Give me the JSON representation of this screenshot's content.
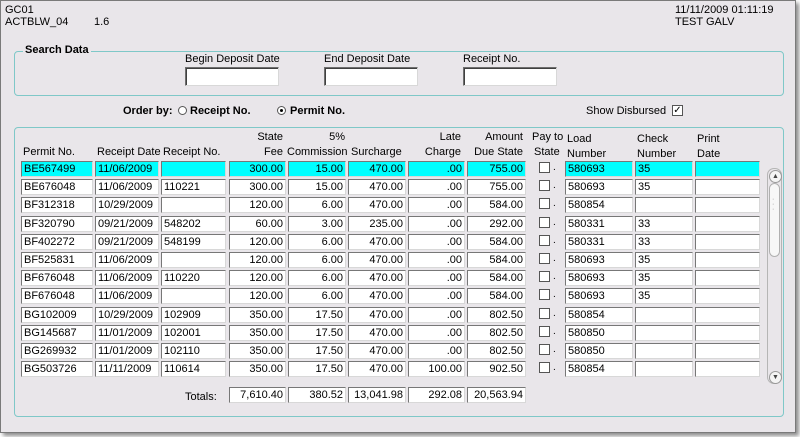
{
  "header": {
    "form_code": "GC01",
    "program": "ACTBLW_04",
    "version": "1.6",
    "datetime": "11/11/2009 01:11:19",
    "environment": "TEST GALV"
  },
  "search": {
    "title": "Search Data",
    "begin_label": "Begin Deposit Date",
    "begin_value": "",
    "end_label": "End Deposit Date",
    "end_value": "",
    "receipt_label": "Receipt No.",
    "receipt_value": ""
  },
  "order": {
    "label": "Order by:",
    "option_receipt": "Receipt No.",
    "option_permit": "Permit No.",
    "selected": "permit"
  },
  "show_disbursed": {
    "label": "Show Disbursed",
    "checked": true,
    "glyph": "✓"
  },
  "columns": {
    "permit": "Permit No.",
    "receipt_date": "Receipt Date",
    "receipt_no": "Receipt No.",
    "state_fee_1": "State",
    "state_fee_2": "Fee",
    "commission_1": "5%",
    "commission_2": "Commission",
    "surcharge": "Surcharge",
    "late_1": "Late",
    "late_2": "Charge",
    "amount_1": "Amount",
    "amount_2": "Due State",
    "pay_1": "Pay to",
    "pay_2": "State",
    "load_1": "Load",
    "load_2": "Number",
    "check_1": "Check",
    "check_2": "Number",
    "print_1": "Print",
    "print_2": "Date"
  },
  "rows": [
    {
      "permit": "BE567499",
      "date": "11/06/2009",
      "receipt": "",
      "fee": "300.00",
      "comm": "15.00",
      "sur": "470.00",
      "late": ".00",
      "amount": "755.00",
      "load": "580693",
      "check": "35",
      "print": ""
    },
    {
      "permit": "BE676048",
      "date": "11/06/2009",
      "receipt": "110221",
      "fee": "300.00",
      "comm": "15.00",
      "sur": "470.00",
      "late": ".00",
      "amount": "755.00",
      "load": "580693",
      "check": "35",
      "print": ""
    },
    {
      "permit": "BF312318",
      "date": "10/29/2009",
      "receipt": "",
      "fee": "120.00",
      "comm": "6.00",
      "sur": "470.00",
      "late": ".00",
      "amount": "584.00",
      "load": "580854",
      "check": "",
      "print": ""
    },
    {
      "permit": "BF320790",
      "date": "09/21/2009",
      "receipt": "548202",
      "fee": "60.00",
      "comm": "3.00",
      "sur": "235.00",
      "late": ".00",
      "amount": "292.00",
      "load": "580331",
      "check": "33",
      "print": ""
    },
    {
      "permit": "BF402272",
      "date": "09/21/2009",
      "receipt": "548199",
      "fee": "120.00",
      "comm": "6.00",
      "sur": "470.00",
      "late": ".00",
      "amount": "584.00",
      "load": "580331",
      "check": "33",
      "print": ""
    },
    {
      "permit": "BF525831",
      "date": "11/06/2009",
      "receipt": "",
      "fee": "120.00",
      "comm": "6.00",
      "sur": "470.00",
      "late": ".00",
      "amount": "584.00",
      "load": "580693",
      "check": "35",
      "print": ""
    },
    {
      "permit": "BF676048",
      "date": "11/06/2009",
      "receipt": "110220",
      "fee": "120.00",
      "comm": "6.00",
      "sur": "470.00",
      "late": ".00",
      "amount": "584.00",
      "load": "580693",
      "check": "35",
      "print": ""
    },
    {
      "permit": "BF676048",
      "date": "11/06/2009",
      "receipt": "",
      "fee": "120.00",
      "comm": "6.00",
      "sur": "470.00",
      "late": ".00",
      "amount": "584.00",
      "load": "580693",
      "check": "35",
      "print": ""
    },
    {
      "permit": "BG102009",
      "date": "10/29/2009",
      "receipt": "102909",
      "fee": "350.00",
      "comm": "17.50",
      "sur": "470.00",
      "late": ".00",
      "amount": "802.50",
      "load": "580854",
      "check": "",
      "print": ""
    },
    {
      "permit": "BG145687",
      "date": "11/01/2009",
      "receipt": "102001",
      "fee": "350.00",
      "comm": "17.50",
      "sur": "470.00",
      "late": ".00",
      "amount": "802.50",
      "load": "580850",
      "check": "",
      "print": ""
    },
    {
      "permit": "BG269932",
      "date": "11/01/2009",
      "receipt": "102110",
      "fee": "350.00",
      "comm": "17.50",
      "sur": "470.00",
      "late": ".00",
      "amount": "802.50",
      "load": "580850",
      "check": "",
      "print": ""
    },
    {
      "permit": "BG503726",
      "date": "11/11/2009",
      "receipt": "110614",
      "fee": "350.00",
      "comm": "17.50",
      "sur": "470.00",
      "late": "100.00",
      "amount": "902.50",
      "load": "580854",
      "check": "",
      "print": ""
    }
  ],
  "totals": {
    "label": "Totals:",
    "fee": "7,610.40",
    "comm": "380.52",
    "sur": "13,041.98",
    "late": "292.08",
    "amount": "20,563.94"
  },
  "colors": {
    "selected_row": "#00ffff",
    "panel": "#e9e6ea",
    "group_border": "#7fc8c8"
  }
}
